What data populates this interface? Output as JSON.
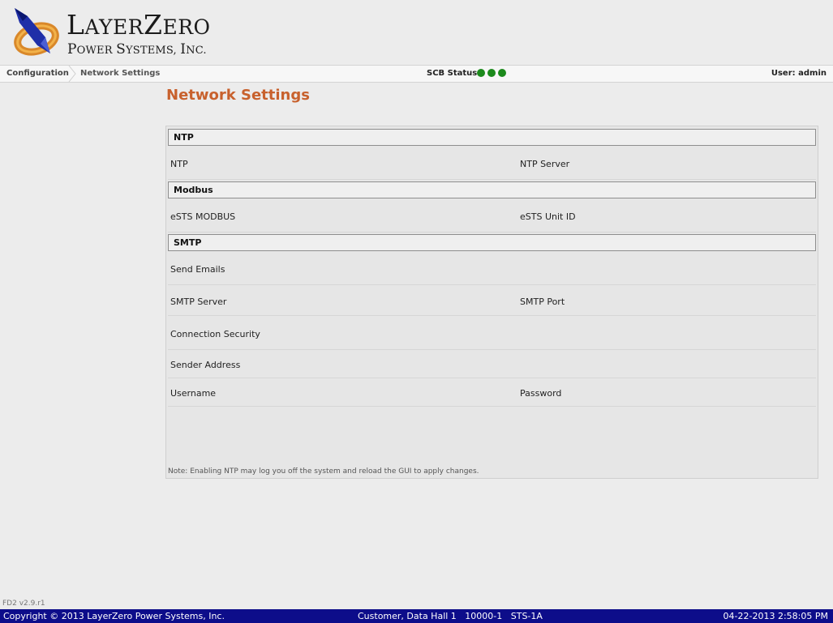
{
  "logo": {
    "line1_a": "L",
    "line1_b": "AYER",
    "line1_c": "Z",
    "line1_d": "ERO",
    "line2_a": "P",
    "line2_b": "OWER ",
    "line2_c": "S",
    "line2_d": "YSTEMS, ",
    "line2_e": "I",
    "line2_f": "NC."
  },
  "breadcrumb": {
    "item1": "Configuration",
    "item2": "Network Settings"
  },
  "status": {
    "label": "SCB Status:",
    "color": "#1c8a1c",
    "indicators": 3
  },
  "user": "User: admin",
  "page_title": "Network Settings",
  "sections": {
    "ntp": {
      "title": "NTP",
      "fields": {
        "ntp": "NTP",
        "ntp_server": "NTP Server"
      }
    },
    "modbus": {
      "title": "Modbus",
      "fields": {
        "ests_modbus": "eSTS MODBUS",
        "ests_unit_id": "eSTS Unit ID"
      }
    },
    "smtp": {
      "title": "SMTP",
      "fields": {
        "send_emails": "Send Emails",
        "smtp_server": "SMTP Server",
        "smtp_port": "SMTP Port",
        "connection_security": "Connection Security",
        "sender_address": "Sender Address",
        "username": "Username",
        "password": "Password"
      }
    }
  },
  "note": "Note: Enabling NTP may log you off the system and reload the GUI to apply changes.",
  "version": "FD2 v2.9.r1",
  "footer": {
    "copyright": "Copyright © 2013 LayerZero Power Systems, Inc.",
    "site": "Customer, Data Hall 1   10000-1   STS-1A",
    "datetime": "04-22-2013 2:58:05 PM"
  },
  "colors": {
    "accent": "#c8612d",
    "footer_bg": "#0d0d8a"
  }
}
